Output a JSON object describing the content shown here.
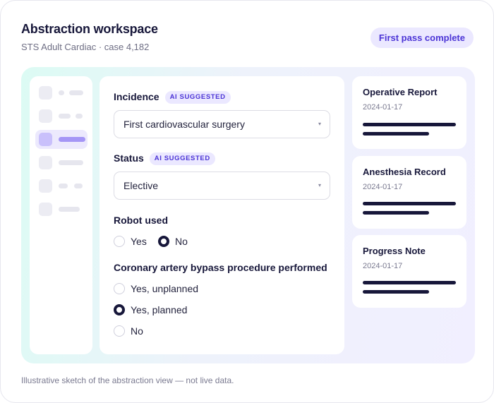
{
  "header": {
    "title": "Abstraction workspace",
    "subtitle": "STS Adult Cardiac · case 4,182",
    "status_badge": "First pass complete"
  },
  "form": {
    "incidence": {
      "label": "Incidence",
      "tag": "AI SUGGESTED",
      "value": "First cardiovascular surgery"
    },
    "status": {
      "label": "Status",
      "tag": "AI SUGGESTED",
      "value": "Elective"
    },
    "robot_used": {
      "label": "Robot used",
      "options": [
        "Yes",
        "No"
      ],
      "selected": "No"
    },
    "cabg": {
      "label": "Coronary artery bypass procedure performed",
      "options": [
        "Yes, unplanned",
        "Yes, planned",
        "No"
      ],
      "selected": "Yes, planned"
    }
  },
  "documents": [
    {
      "title": "Operative Report",
      "date": "2024-01-17"
    },
    {
      "title": "Anesthesia Record",
      "date": "2024-01-17"
    },
    {
      "title": "Progress Note",
      "date": "2024-01-17"
    }
  ],
  "footnote": "Illustrative sketch of the abstraction view — not live data.",
  "colors": {
    "accent": "#4b34d6",
    "accent_bg": "#ebe8ff",
    "ink": "#17173a"
  }
}
